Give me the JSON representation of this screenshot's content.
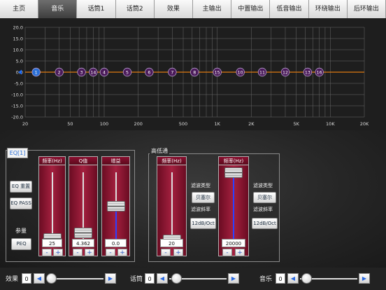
{
  "tabs": [
    {
      "label": "主页",
      "active": false
    },
    {
      "label": "音乐",
      "active": true
    },
    {
      "label": "话筒1",
      "active": false
    },
    {
      "label": "话筒2",
      "active": false
    },
    {
      "label": "效果",
      "active": false
    },
    {
      "label": "主输出",
      "active": false
    },
    {
      "label": "中置输出",
      "active": false
    },
    {
      "label": "低音输出",
      "active": false
    },
    {
      "label": "环绕输出",
      "active": false
    },
    {
      "label": "后环输出",
      "active": false
    }
  ],
  "chart_data": {
    "type": "line",
    "x_scale": "log",
    "xlim": [
      20,
      20000
    ],
    "ylim": [
      -20,
      20
    ],
    "ytick_labels": [
      "20.0",
      "15.0",
      "10.0",
      "5.0",
      "0.0",
      "-5.0",
      "-10.0",
      "-15.0",
      "-20.0"
    ],
    "yticks": [
      20,
      15,
      10,
      5,
      0,
      -5,
      -10,
      -15,
      -20
    ],
    "xtick_labels": [
      "20",
      "50",
      "100",
      "200",
      "500",
      "1K",
      "2K",
      "5K",
      "10K",
      "20K"
    ],
    "xticks": [
      20,
      50,
      100,
      200,
      500,
      1000,
      2000,
      5000,
      10000,
      20000
    ],
    "series": [
      {
        "x": [
          20,
          20000
        ],
        "y": [
          0,
          0
        ]
      }
    ],
    "band_points": [
      {
        "label": "1",
        "freq": 25,
        "gain": 0
      },
      {
        "label": "2",
        "freq": 40,
        "gain": 0
      },
      {
        "label": "3",
        "freq": 63,
        "gain": 0
      },
      {
        "label": "14",
        "freq": 80,
        "gain": 0
      },
      {
        "label": "4",
        "freq": 100,
        "gain": 0
      },
      {
        "label": "5",
        "freq": 160,
        "gain": 0
      },
      {
        "label": "6",
        "freq": 250,
        "gain": 0
      },
      {
        "label": "7",
        "freq": 400,
        "gain": 0
      },
      {
        "label": "8",
        "freq": 630,
        "gain": 0
      },
      {
        "label": "15",
        "freq": 1000,
        "gain": 0
      },
      {
        "label": "10",
        "freq": 1600,
        "gain": 0
      },
      {
        "label": "11",
        "freq": 2500,
        "gain": 0
      },
      {
        "label": "12",
        "freq": 4000,
        "gain": 0
      },
      {
        "label": "13",
        "freq": 6300,
        "gain": 0
      },
      {
        "label": "16",
        "freq": 8000,
        "gain": 0
      }
    ],
    "selected_band": "1",
    "colors": {
      "curve": "#e07a10",
      "grid": "#6a6a6a",
      "point_fill": "#4a1a5a",
      "selected_fill": "#2a6fd6",
      "marker": "#1f6fff"
    }
  },
  "eq": {
    "tag": "EQ[1]",
    "reset_label": "EQ 重置",
    "pass_label": "EQ PASS",
    "param_label": "参量",
    "peq_label": "PEQ",
    "sliders": [
      {
        "header": "频率(Hz)",
        "value": "25",
        "level": 0.02
      },
      {
        "header": "Q值",
        "value": "4.362",
        "level": 0.1
      },
      {
        "header": "增益",
        "value": "0.0",
        "level": 0.5
      }
    ],
    "minus": "-",
    "plus": "+"
  },
  "hilo": {
    "title": "高低通",
    "filter_type_label": "滤波类型",
    "filter_slope_label": "滤波斜率",
    "filters": [
      {
        "header": "频率(Hz)",
        "value": "20",
        "level": 0.0,
        "type": "贝塞尔",
        "slope": "12dB/Oct"
      },
      {
        "header": "频率(Hz)",
        "value": "20000",
        "level": 1.0,
        "type": "贝塞尔",
        "slope": "12dB/Oct"
      }
    ]
  },
  "volumes": [
    {
      "label": "效果",
      "value": "0",
      "level": 0.0
    },
    {
      "label": "话筒",
      "value": "0",
      "level": 0.0
    },
    {
      "label": "音乐",
      "value": "0",
      "level": 0.0
    }
  ],
  "arrows": {
    "left": "◀",
    "right": "▶"
  }
}
